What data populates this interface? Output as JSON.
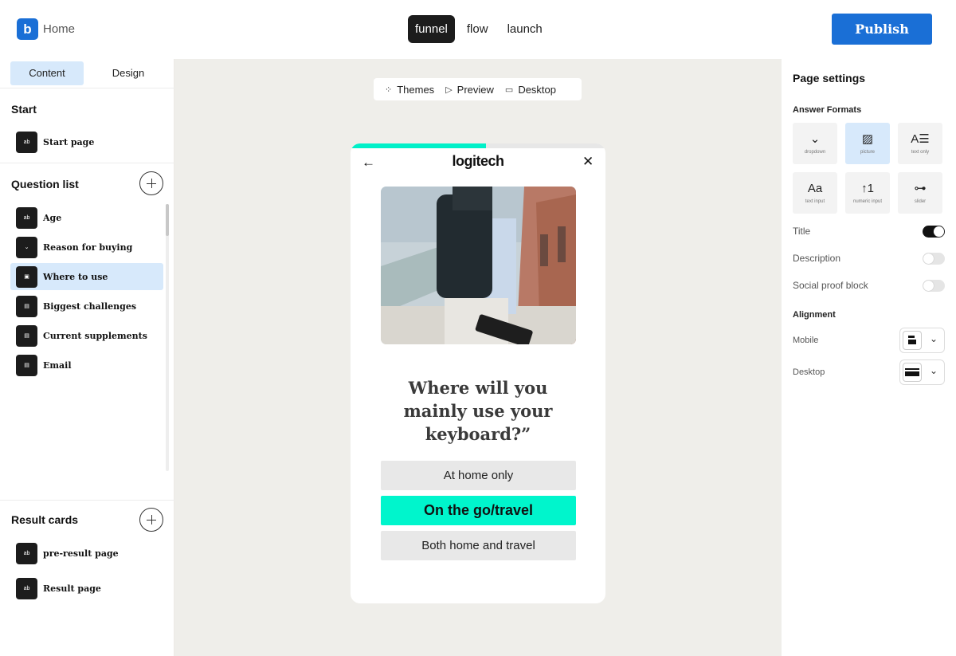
{
  "app": {
    "logo_letter": "b",
    "home_label": "Home",
    "top_tabs": [
      "funnel",
      "flow",
      "launch"
    ],
    "active_top_tab": "funnel",
    "publish_label": "Publish",
    "accent_color": "#1a6fd6"
  },
  "sidebar": {
    "tabs": [
      "Content",
      "Design"
    ],
    "active_tab": "Content",
    "start": {
      "title": "Start",
      "items": [
        {
          "label": "Start page",
          "icon_text": "ab"
        }
      ]
    },
    "questions": {
      "title": "Question list",
      "items": [
        {
          "label": "Age",
          "icon_text": "ab"
        },
        {
          "label": "Reason for buying",
          "icon_text": "⌄"
        },
        {
          "label": "Where to use",
          "icon_text": "▣"
        },
        {
          "label": "Biggest challenges",
          "icon_text": "▤"
        },
        {
          "label": "Current supplements",
          "icon_text": "▤"
        },
        {
          "label": "Email",
          "icon_text": "▤"
        }
      ],
      "selected": "Where to use"
    },
    "results": {
      "title": "Result cards",
      "items": [
        {
          "label": "pre-result page",
          "icon_text": "ab"
        },
        {
          "label": "Result page",
          "icon_text": "ab"
        }
      ]
    }
  },
  "canvas": {
    "toolbar": {
      "themes": "Themes",
      "preview": "Preview",
      "desktop": "Desktop"
    },
    "phone": {
      "progress": 0.53,
      "brand": "logitech",
      "question": "Where will you mainly use your keyboard?”",
      "options": [
        "At home only",
        "On the go/travel",
        "Both home and travel"
      ],
      "selected_option": "On the go/travel",
      "highlight_color": "#00f5cc"
    }
  },
  "right_panel": {
    "title": "Page settings",
    "answer_formats_title": "Answer Formats",
    "formats": [
      {
        "label": "dropdown",
        "icon": "chevron-down-icon",
        "glyph": "⌄"
      },
      {
        "label": "picture",
        "icon": "image-icon",
        "glyph": "▨"
      },
      {
        "label": "text only",
        "icon": "text-only-icon",
        "glyph": "A☰"
      },
      {
        "label": "text input",
        "icon": "text-input-icon",
        "glyph": "Aa"
      },
      {
        "label": "numeric input",
        "icon": "numeric-input-icon",
        "glyph": "↑1"
      },
      {
        "label": "slider",
        "icon": "slider-icon",
        "glyph": "⊶"
      }
    ],
    "active_format": "picture",
    "settings": [
      {
        "label": "Title",
        "on": true
      },
      {
        "label": "Description",
        "on": false
      },
      {
        "label": "Social proof block",
        "on": false
      }
    ],
    "alignment_title": "Alignment",
    "alignment": [
      {
        "label": "Mobile"
      },
      {
        "label": "Desktop"
      }
    ]
  }
}
